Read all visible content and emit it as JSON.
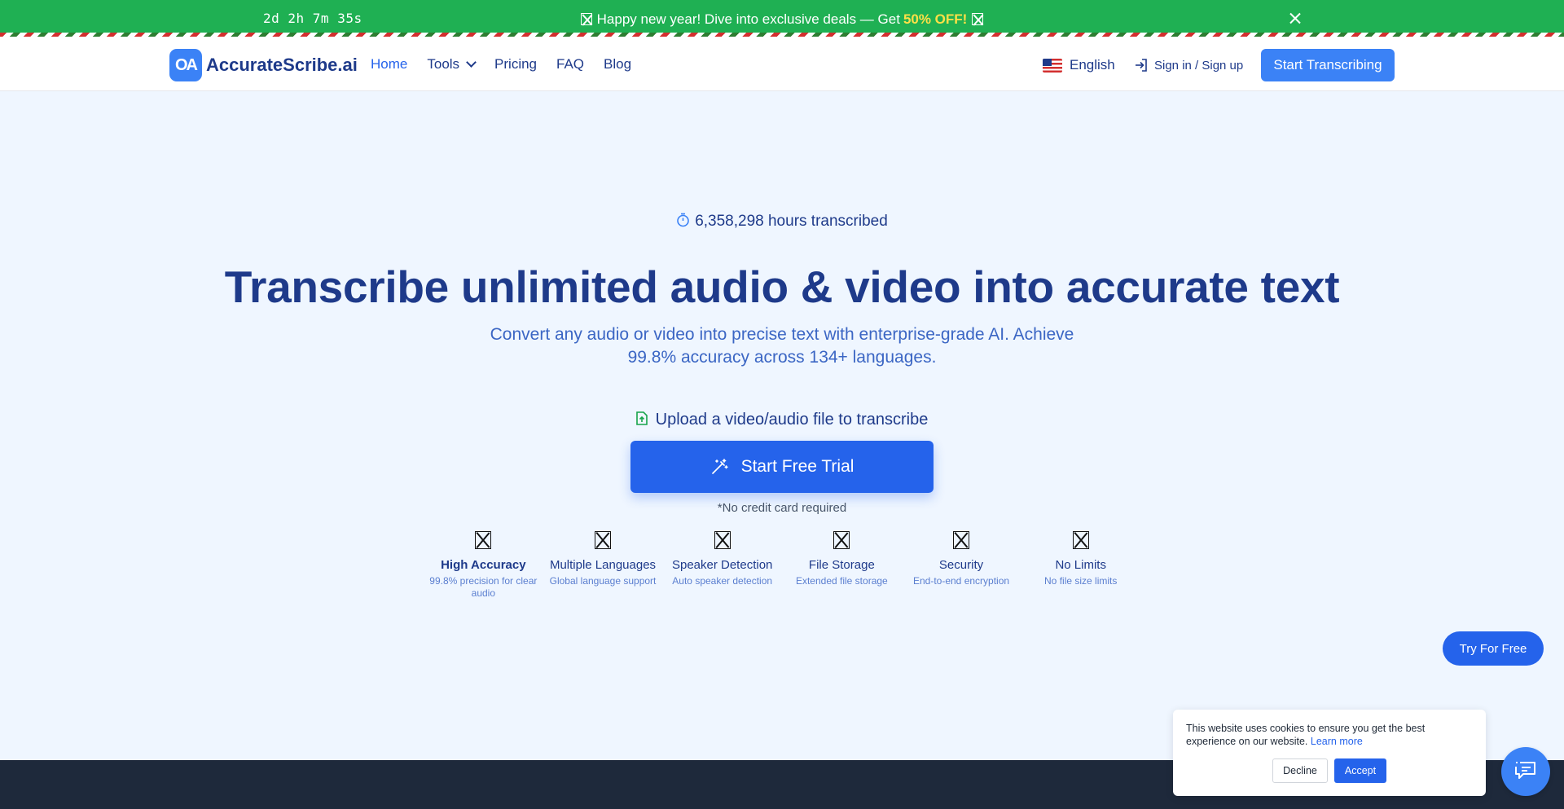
{
  "promo": {
    "countdown": "2d 2h 7m 35s",
    "message": "Happy new year! Dive into exclusive deals — Get",
    "deal": "50% OFF!"
  },
  "nav": {
    "logo_mark": "OA",
    "brand": "AccurateScribe.ai",
    "links": [
      "Home",
      "Tools",
      "Pricing",
      "FAQ",
      "Blog"
    ],
    "language": "English",
    "signin": "Sign in / Sign up",
    "cta": "Start Transcribing"
  },
  "hero": {
    "stat": "6,358,298 hours transcribed",
    "headline": "Transcribe unlimited audio & video into accurate text",
    "subheadline": "Convert any audio or video into precise text with enterprise-grade AI. Achieve 99.8% accuracy across 134+ languages.",
    "upload_label": "Upload a video/audio file to transcribe",
    "cta": "Start Free Trial",
    "note": "*No credit card required"
  },
  "features": [
    {
      "title": "High Accuracy",
      "desc": "99.8% precision for clear audio"
    },
    {
      "title": "Multiple Languages",
      "desc": "Global language support"
    },
    {
      "title": "Speaker Detection",
      "desc": "Auto speaker detection"
    },
    {
      "title": "File Storage",
      "desc": "Extended file storage"
    },
    {
      "title": "Security",
      "desc": "End-to-end encryption"
    },
    {
      "title": "No Limits",
      "desc": "No file size limits"
    }
  ],
  "floating": {
    "try_free": "Try For Free"
  },
  "cookie": {
    "text": "This website uses cookies to ensure you get the best experience on our website.",
    "learn_more": "Learn more",
    "decline": "Decline",
    "accept": "Accept"
  },
  "colors": {
    "promo_bg": "#1fb053",
    "primary": "#2563eb",
    "navy": "#1e3a8a",
    "hero_bg": "#eff6ff",
    "footer_bg": "#1e293b"
  },
  "icons": {
    "stat": "stopwatch-icon",
    "upload": "file-upload-icon",
    "cta": "magic-wand-icon",
    "signin": "login-icon",
    "chat": "chat-bubble-icon"
  }
}
